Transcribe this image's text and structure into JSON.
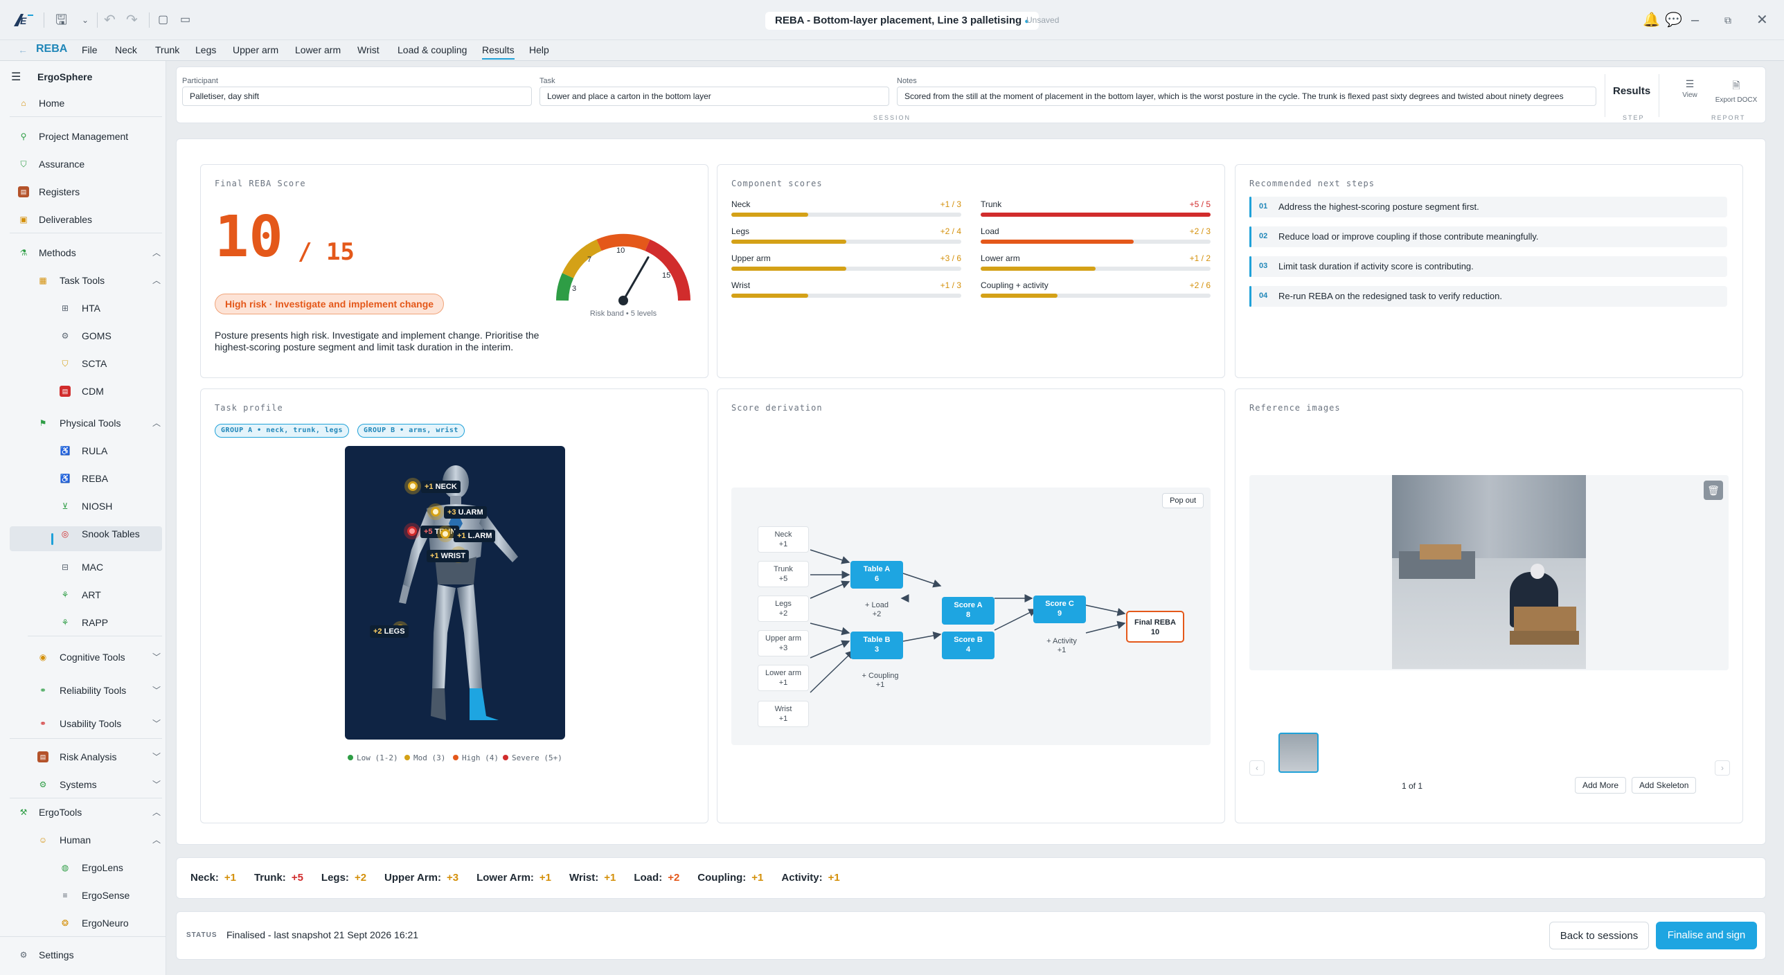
{
  "app": {
    "logo": "ErgoSphere logo",
    "title": "REBA - Bottom-layer placement, Line 3 palletising",
    "saved_state": "Unsaved"
  },
  "menu": [
    "REBA",
    "File",
    "Neck",
    "Trunk",
    "Legs",
    "Upper arm",
    "Lower arm",
    "Wrist",
    "Load & coupling",
    "Results",
    "Help"
  ],
  "menu_active": "Results",
  "sidebar": {
    "brand": "ErgoSphere",
    "home": "Home",
    "project_management": "Project Management",
    "assurance": "Assurance",
    "registers": "Registers",
    "deliverables": "Deliverables",
    "methods": "Methods",
    "task_tools": "Task Tools",
    "task_items": [
      "HTA",
      "GOMS",
      "SCTA",
      "CDM"
    ],
    "physical_tools": "Physical Tools",
    "physical_items": [
      "RULA",
      "REBA",
      "NIOSH",
      "Snook Tables",
      "MAC",
      "ART",
      "RAPP"
    ],
    "cognitive_tools": "Cognitive Tools",
    "reliability_tools": "Reliability Tools",
    "usability_tools": "Usability Tools",
    "risk_analysis": "Risk Analysis",
    "systems": "Systems",
    "ergotools": "ErgoTools",
    "human": "Human",
    "human_items": [
      "ErgoLens",
      "ErgoSense",
      "ErgoNeuro"
    ],
    "settings": "Settings"
  },
  "session": {
    "participant_label": "Participant",
    "participant": "Palletiser, day shift",
    "task_label": "Task",
    "task": "Lower and place a carton in the bottom layer",
    "notes_label": "Notes",
    "notes": "Scored from the still at the moment of placement in the bottom layer, which is the worst posture in the cycle. The trunk is flexed past sixty degrees and twisted about ninety degrees",
    "session_caption": "SESSION",
    "step_label": "Results",
    "step_caption": "STEP",
    "view_label": "View",
    "export_label": "Export DOCX",
    "report_caption": "REPORT"
  },
  "final_score": {
    "title": "Final REBA Score",
    "score": "10",
    "max": "/ 15",
    "badge": "High risk · Investigate and implement change",
    "description": "Posture presents high risk. Investigate and implement change. Prioritise the highest-scoring posture segment and limit task duration in the interim.",
    "gauge_ticks": [
      "3",
      "7",
      "10",
      "15"
    ],
    "gauge_value": 10,
    "gauge_caption": "Risk band • 5 levels"
  },
  "components": {
    "title": "Component scores",
    "left": [
      {
        "label": "Neck",
        "value": "+1 / 3",
        "fraction": 0.333,
        "color": "#d4a117"
      },
      {
        "label": "Legs",
        "value": "+2 / 4",
        "fraction": 0.5,
        "color": "#d4a117"
      },
      {
        "label": "Upper arm",
        "value": "+3 / 6",
        "fraction": 0.5,
        "color": "#d4a117"
      },
      {
        "label": "Wrist",
        "value": "+1 / 3",
        "fraction": 0.333,
        "color": "#d4a117"
      }
    ],
    "right": [
      {
        "label": "Trunk",
        "value": "+5 / 5",
        "fraction": 1.0,
        "color": "#d12c2c"
      },
      {
        "label": "Load",
        "value": "+2 / 3",
        "fraction": 0.667,
        "color": "#e4581a"
      },
      {
        "label": "Lower arm",
        "value": "+1 / 2",
        "fraction": 0.5,
        "color": "#d4a117"
      },
      {
        "label": "Coupling + activity",
        "value": "+2 / 6",
        "fraction": 0.333,
        "color": "#d4a117"
      }
    ]
  },
  "next_steps": {
    "title": "Recommended next steps",
    "items": [
      {
        "n": "01",
        "text": "Address the highest-scoring posture segment first."
      },
      {
        "n": "02",
        "text": "Reduce load or improve coupling if those contribute meaningfully."
      },
      {
        "n": "03",
        "text": "Limit task duration if activity score is contributing."
      },
      {
        "n": "04",
        "text": "Re-run REBA on the redesigned task to verify reduction."
      }
    ]
  },
  "task_profile": {
    "title": "Task profile",
    "chip_a": "GROUP A • neck, trunk, legs",
    "chip_b": "GROUP B • arms, wrist",
    "labels": [
      {
        "score": "+1",
        "name": "NECK"
      },
      {
        "score": "+3",
        "name": "U.ARM"
      },
      {
        "score": "+5",
        "name": "TRUN"
      },
      {
        "score": "+1",
        "name": "L.ARM"
      },
      {
        "score": "+1",
        "name": "WRIST"
      },
      {
        "score": "+2",
        "name": "LEGS"
      }
    ],
    "legend": [
      "Low (1-2)",
      "Mod (3)",
      "High (4)",
      "Severe (5+)"
    ]
  },
  "derivation": {
    "title": "Score derivation",
    "popout": "Pop out",
    "inputs": [
      {
        "name": "Neck",
        "val": "+1"
      },
      {
        "name": "Trunk",
        "val": "+5"
      },
      {
        "name": "Legs",
        "val": "+2"
      },
      {
        "name": "Upper arm",
        "val": "+3"
      },
      {
        "name": "Lower arm",
        "val": "+1"
      },
      {
        "name": "Wrist",
        "val": "+1"
      }
    ],
    "table_a": {
      "name": "Table A",
      "val": "6"
    },
    "table_b": {
      "name": "Table B",
      "val": "3"
    },
    "load": {
      "name": "+ Load",
      "val": "+2"
    },
    "coupling": {
      "name": "+ Coupling",
      "val": "+1"
    },
    "score_a": {
      "name": "Score A",
      "val": "8"
    },
    "score_b": {
      "name": "Score B",
      "val": "4"
    },
    "score_c": {
      "name": "Score C",
      "val": "9"
    },
    "activity": {
      "name": "+ Activity",
      "val": "+1"
    },
    "final": {
      "name": "Final REBA",
      "val": "10"
    }
  },
  "reference": {
    "title": "Reference images",
    "counter": "1 of 1",
    "add_more": "Add More",
    "add_skeleton": "Add Skeleton"
  },
  "strip": [
    {
      "k": "Neck:",
      "v": "+1",
      "c": "#d4900a"
    },
    {
      "k": "Trunk:",
      "v": "+5",
      "c": "#d12c2c"
    },
    {
      "k": "Legs:",
      "v": "+2",
      "c": "#d4900a"
    },
    {
      "k": "Upper Arm:",
      "v": "+3",
      "c": "#d4900a"
    },
    {
      "k": "Lower Arm:",
      "v": "+1",
      "c": "#d4900a"
    },
    {
      "k": "Wrist:",
      "v": "+1",
      "c": "#d4900a"
    },
    {
      "k": "Load:",
      "v": "+2",
      "c": "#e4581a"
    },
    {
      "k": "Coupling:",
      "v": "+1",
      "c": "#d4900a"
    },
    {
      "k": "Activity:",
      "v": "+1",
      "c": "#d4900a"
    }
  ],
  "status": {
    "label": "STATUS",
    "text": "Finalised - last snapshot 21 Sept 2026 16:21",
    "back": "Back to sessions",
    "finalise": "Finalise and sign"
  },
  "colors": {
    "accent": "#1fa1d8",
    "high": "#e4581a",
    "severe": "#d12c2c",
    "moderate": "#d4a117",
    "low": "#2e9d45"
  }
}
